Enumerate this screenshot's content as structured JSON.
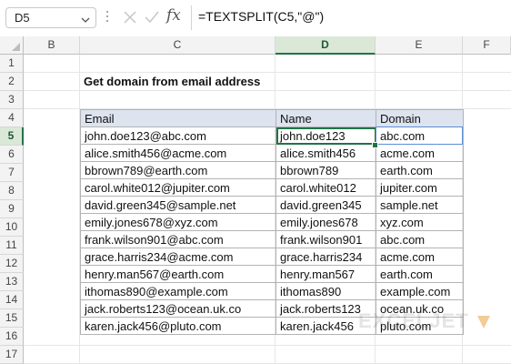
{
  "formula_bar": {
    "name_box": "D5",
    "fx_label": "fx",
    "formula": "=TEXTSPLIT(C5,\"@\")"
  },
  "columns": [
    "B",
    "C",
    "D",
    "E",
    "F"
  ],
  "rows": [
    "1",
    "2",
    "3",
    "4",
    "5",
    "6",
    "7",
    "8",
    "9",
    "10",
    "11",
    "12",
    "13",
    "14",
    "15",
    "16",
    "17"
  ],
  "selected_column": "D",
  "selected_row": "5",
  "title": "Get domain from email address",
  "table": {
    "headers": [
      "Email",
      "Name",
      "Domain"
    ],
    "rows": [
      [
        "john.doe123@abc.com",
        "john.doe123",
        "abc.com"
      ],
      [
        "alice.smith456@acme.com",
        "alice.smith456",
        "acme.com"
      ],
      [
        "bbrown789@earth.com",
        "bbrown789",
        "earth.com"
      ],
      [
        "carol.white012@jupiter.com",
        "carol.white012",
        "jupiter.com"
      ],
      [
        "david.green345@sample.net",
        "david.green345",
        "sample.net"
      ],
      [
        "emily.jones678@xyz.com",
        "emily.jones678",
        "xyz.com"
      ],
      [
        "frank.wilson901@abc.com",
        "frank.wilson901",
        "abc.com"
      ],
      [
        "grace.harris234@acme.com",
        "grace.harris234",
        "acme.com"
      ],
      [
        "henry.man567@earth.com",
        "henry.man567",
        "earth.com"
      ],
      [
        "ithomas890@example.com",
        "ithomas890",
        "example.com"
      ],
      [
        "jack.roberts123@ocean.uk.co",
        "jack.roberts123",
        "ocean.uk.co"
      ],
      [
        "karen.jack456@pluto.com",
        "karen.jack456",
        "pluto.com"
      ]
    ]
  },
  "watermark": "EXCELJET",
  "colors": {
    "accent": "#217346",
    "header_fill": "#dde3ef",
    "watermark_orange": "#e8a33d"
  }
}
